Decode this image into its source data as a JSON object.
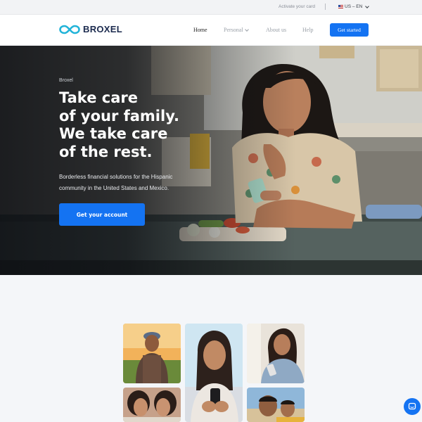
{
  "topbar": {
    "activate_card": "Activate your card",
    "language": "US – EN"
  },
  "nav": {
    "brand": "BROXEL",
    "items": [
      {
        "label": "Home"
      },
      {
        "label": "Personal"
      },
      {
        "label": "About us"
      },
      {
        "label": "Help"
      }
    ],
    "cta": "Get started"
  },
  "hero": {
    "eyebrow": "Broxel",
    "headline": [
      "Take care",
      "of your family.",
      "We take care",
      "of the rest."
    ],
    "subtext_lines": [
      "Borderless financial solutions for the Hispanic",
      "community in the United States and Mexico."
    ],
    "cta": "Get your account"
  },
  "colors": {
    "accent": "#1473f2",
    "brand_navy": "#1b2a4e",
    "logo_cyan": "#21b3d8"
  },
  "icons": {
    "language_flag": "us-flag-icon",
    "dropdown": "chevron-down-icon",
    "chat": "chat-icon"
  }
}
